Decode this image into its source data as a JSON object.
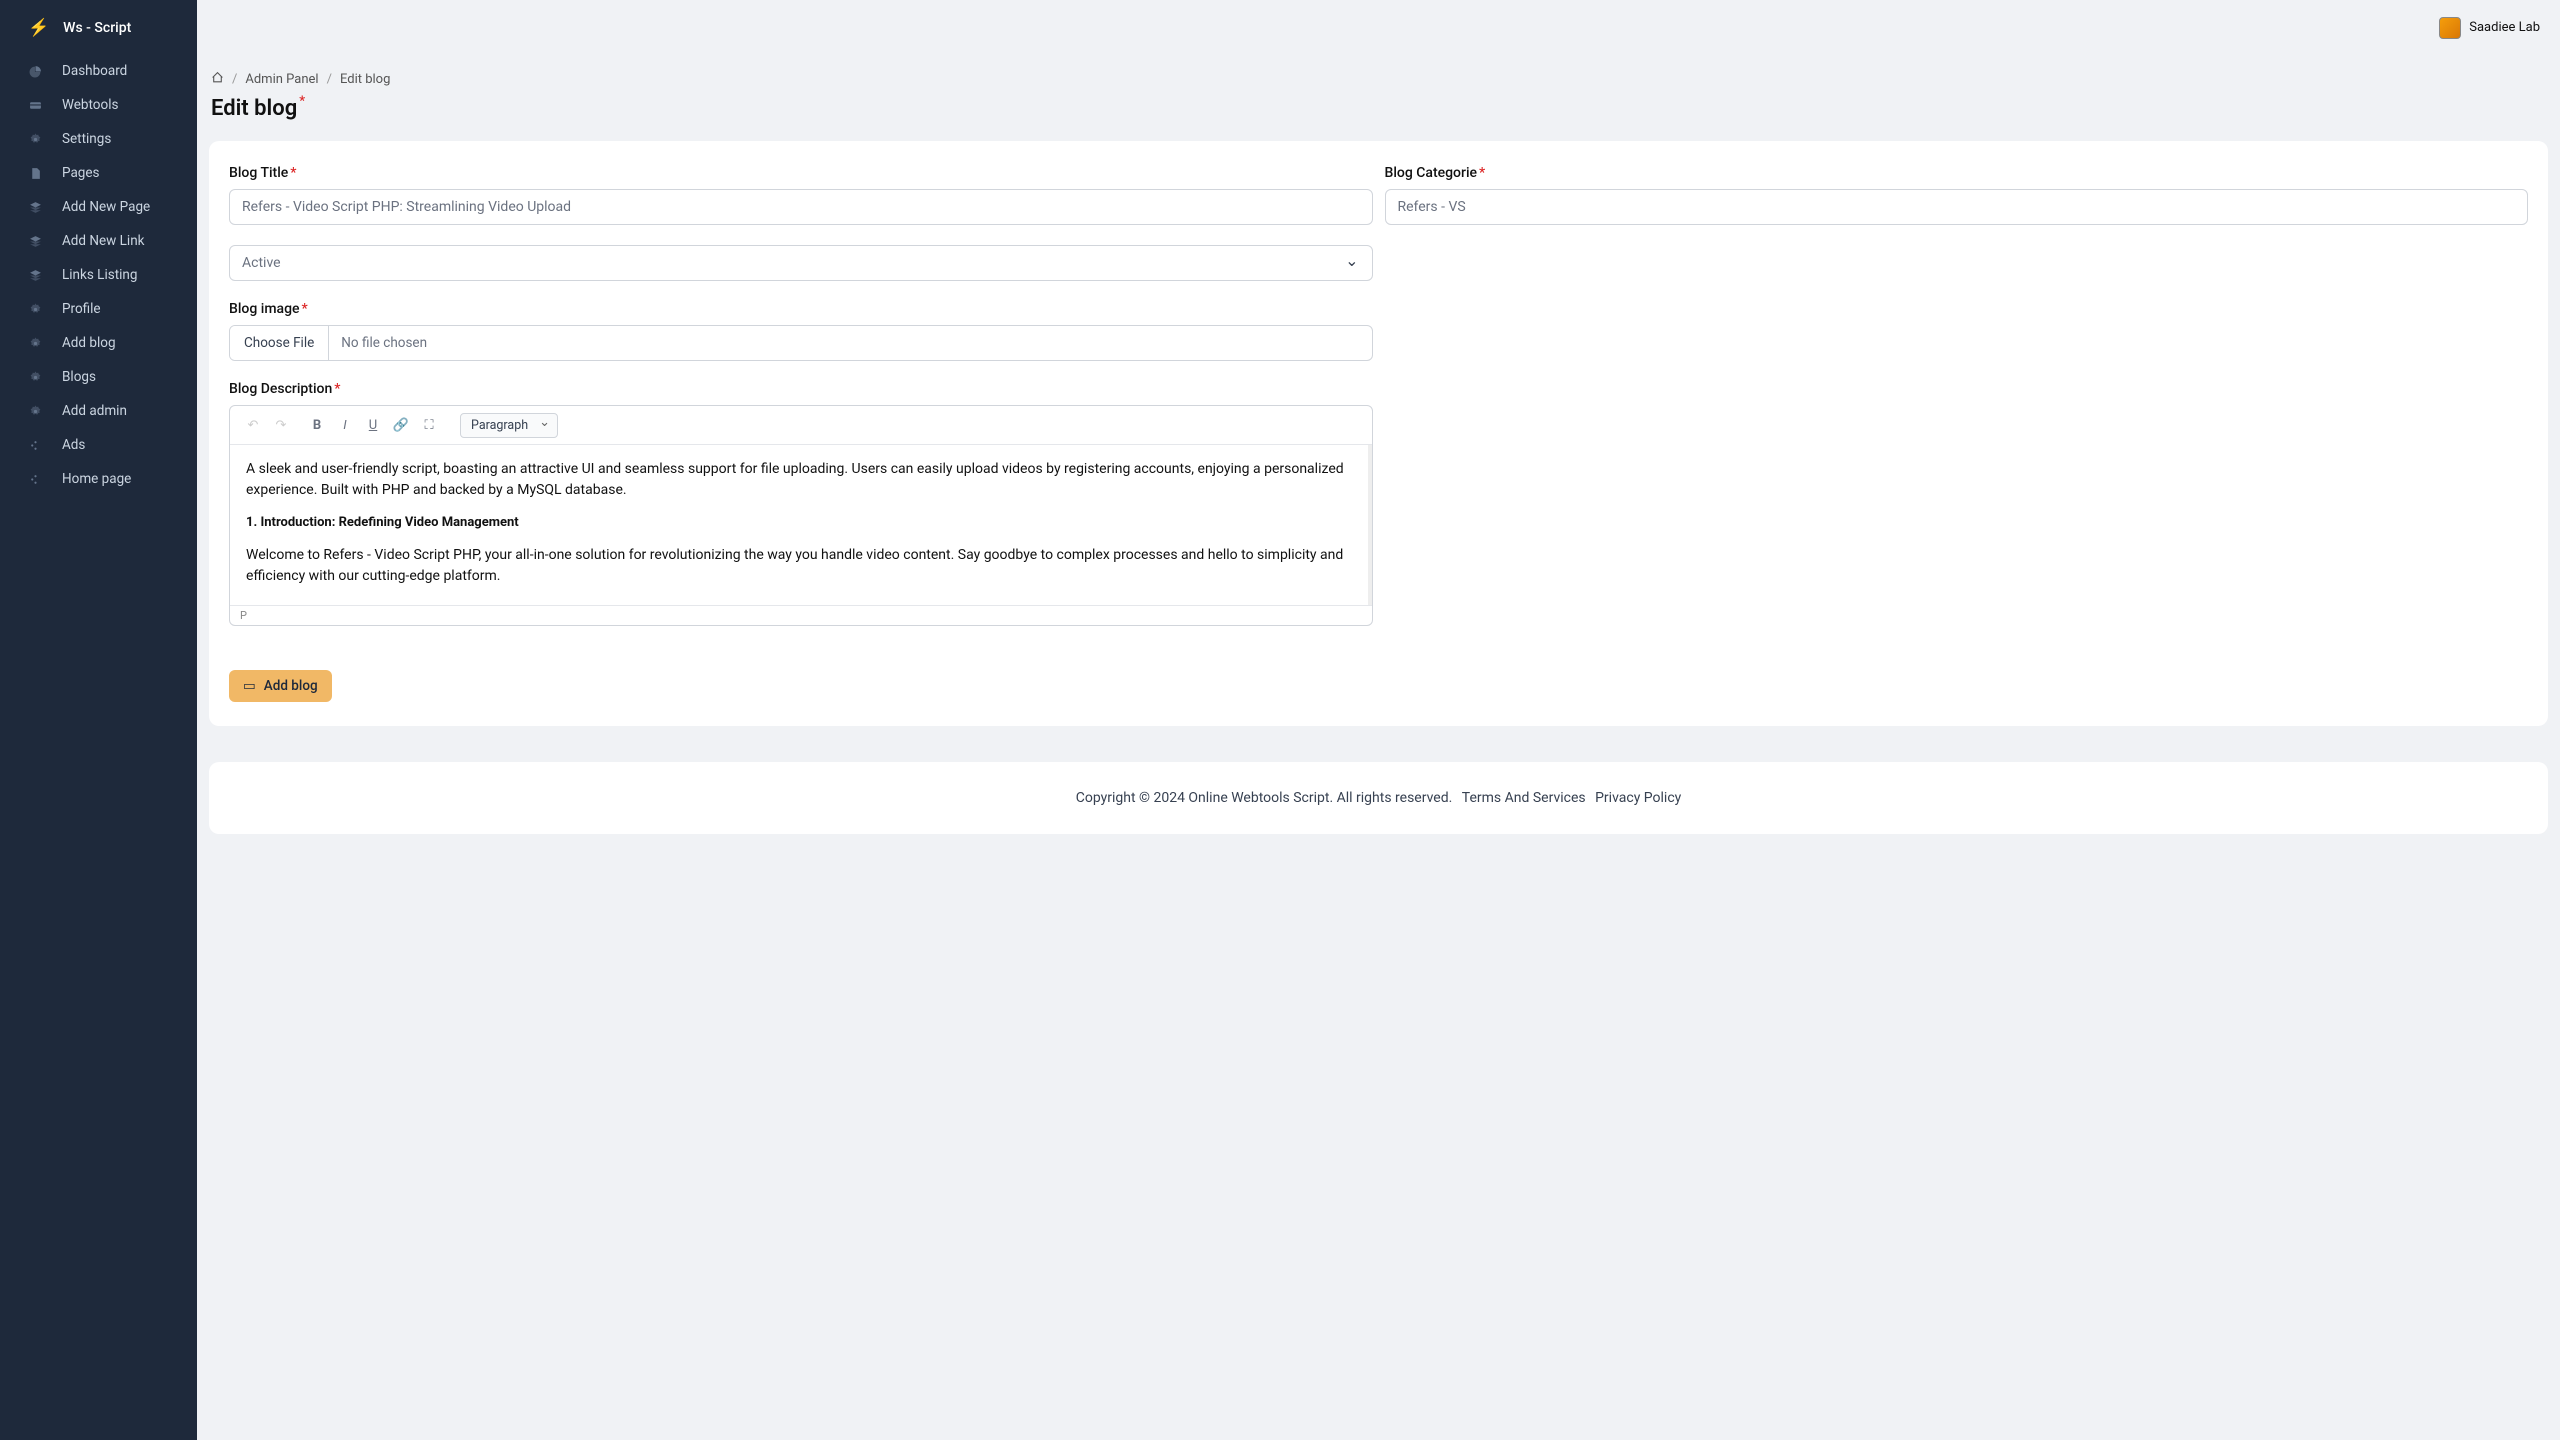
{
  "brand": "Ws - Script",
  "nav": [
    {
      "icon": "pie",
      "label": "Dashboard"
    },
    {
      "icon": "card",
      "label": "Webtools"
    },
    {
      "icon": "gear",
      "label": "Settings"
    },
    {
      "icon": "doc",
      "label": "Pages"
    },
    {
      "icon": "layers",
      "label": "Add New Page"
    },
    {
      "icon": "layers",
      "label": "Add New Link"
    },
    {
      "icon": "layers",
      "label": "Links Listing"
    },
    {
      "icon": "gear",
      "label": "Profile"
    },
    {
      "icon": "gear",
      "label": "Add blog"
    },
    {
      "icon": "gear",
      "label": "Blogs"
    },
    {
      "icon": "gear",
      "label": "Add admin"
    },
    {
      "icon": "dots",
      "label": "Ads"
    },
    {
      "icon": "dots",
      "label": "Home page"
    }
  ],
  "user": "Saadiee Lab",
  "breadcrumb": {
    "admin": "Admin Panel",
    "current": "Edit blog"
  },
  "page_title": "Edit blog",
  "form": {
    "title_label": "Blog Title",
    "title_value": "Refers - Video Script PHP: Streamlining Video Upload",
    "category_label": "Blog Categorie",
    "category_value": "Refers - VS",
    "status_value": "Active",
    "image_label": "Blog image",
    "choose_file": "Choose File",
    "no_file": "No file chosen",
    "desc_label": "Blog Description",
    "format": "Paragraph",
    "body_p1": "A sleek and user-friendly script, boasting an attractive UI and seamless support for file uploading. Users can easily upload videos by registering accounts, enjoying a personalized experience. Built with PHP and backed by a MySQL database.",
    "body_h": "1. Introduction: Redefining Video Management",
    "body_p2": "Welcome to Refers - Video Script PHP, your all-in-one solution for revolutionizing the way you handle video content. Say goodbye to complex processes and hello to simplicity and efficiency with our cutting-edge platform.",
    "status_path": "P",
    "submit": "Add blog"
  },
  "footer": {
    "copy": "Copyright © 2024 Online Webtools Script. All rights reserved.",
    "terms": "Terms And Services",
    "privacy": "Privacy Policy"
  }
}
